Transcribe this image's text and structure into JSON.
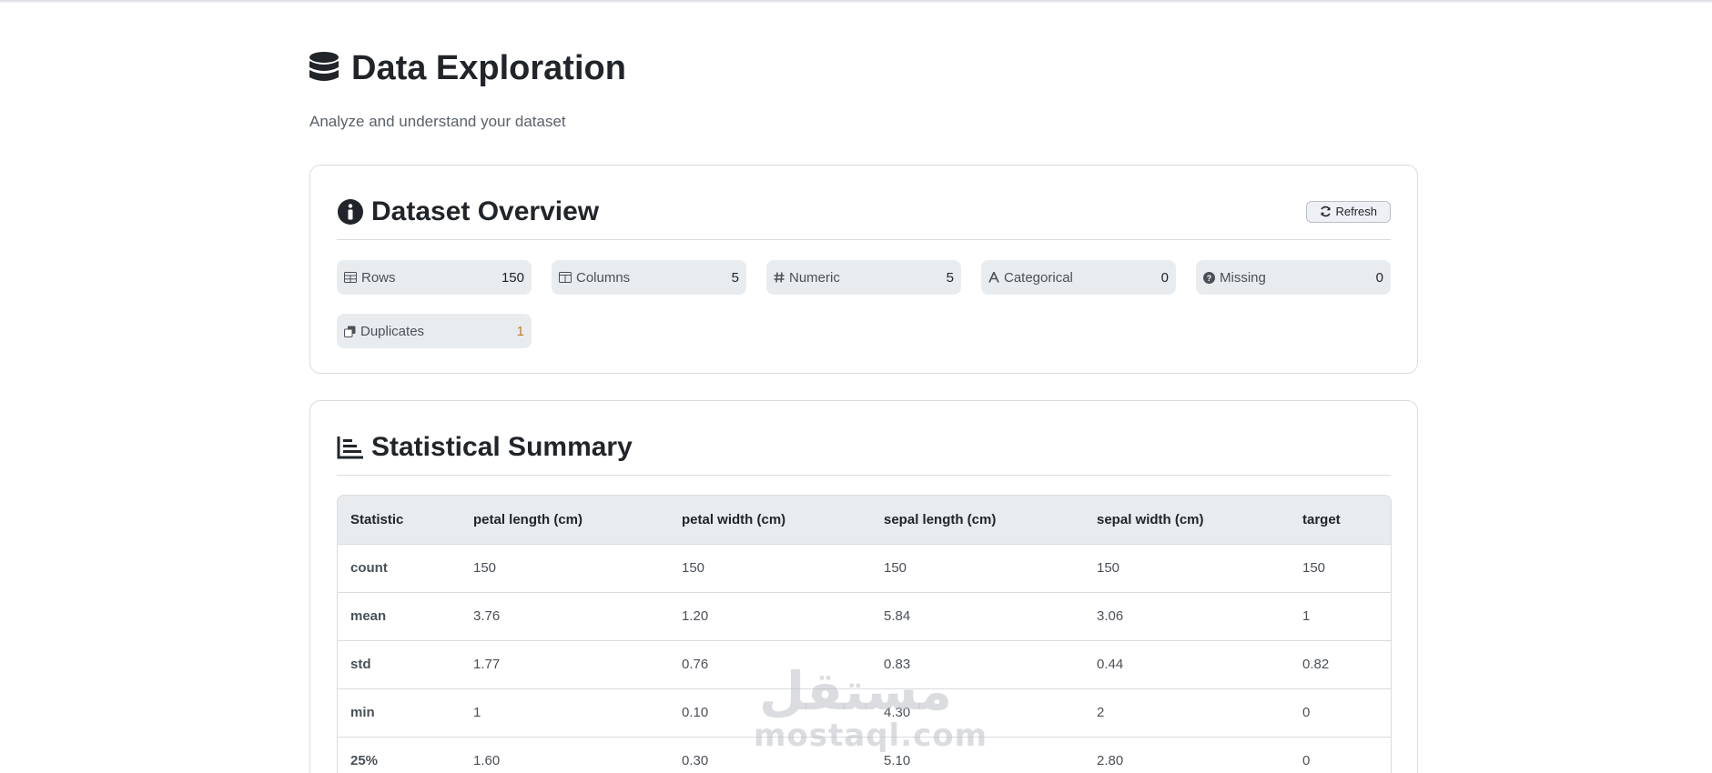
{
  "page": {
    "title": "Data Exploration",
    "subtitle": "Analyze and understand your dataset",
    "title_icon": "database-icon"
  },
  "overview": {
    "title": "Dataset Overview",
    "title_icon": "info-circle-icon",
    "refresh_label": "Refresh",
    "stats": [
      {
        "label": "Rows",
        "value": "150",
        "icon": "table-icon"
      },
      {
        "label": "Columns",
        "value": "5",
        "icon": "columns-icon"
      },
      {
        "label": "Numeric",
        "value": "5",
        "icon": "hash-icon"
      },
      {
        "label": "Categorical",
        "value": "0",
        "icon": "font-icon"
      },
      {
        "label": "Missing",
        "value": "0",
        "icon": "question-circle-icon"
      },
      {
        "label": "Duplicates",
        "value": "1",
        "icon": "copy-icon",
        "value_color": "#c47a2c"
      }
    ]
  },
  "summary": {
    "title": "Statistical Summary",
    "title_icon": "bar-chart-icon",
    "headers": [
      "Statistic",
      "petal length (cm)",
      "petal width (cm)",
      "sepal length (cm)",
      "sepal width (cm)",
      "target"
    ],
    "rows": [
      [
        "count",
        "150",
        "150",
        "150",
        "150",
        "150"
      ],
      [
        "mean",
        "3.76",
        "1.20",
        "5.84",
        "3.06",
        "1"
      ],
      [
        "std",
        "1.77",
        "0.76",
        "0.83",
        "0.44",
        "0.82"
      ],
      [
        "min",
        "1",
        "0.10",
        "4.30",
        "2",
        "0"
      ],
      [
        "25%",
        "1.60",
        "0.30",
        "5.10",
        "2.80",
        "0"
      ]
    ]
  },
  "watermark": {
    "arabic": "مستقل",
    "latin": "mostaql.com"
  }
}
